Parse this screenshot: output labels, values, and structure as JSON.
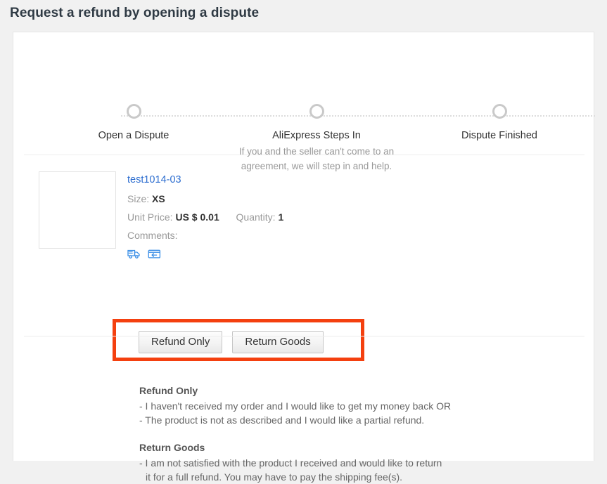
{
  "page": {
    "title": "Request a refund by opening a dispute"
  },
  "stepper": {
    "steps": [
      {
        "label": "Open a Dispute",
        "description": ""
      },
      {
        "label": "AliExpress Steps In",
        "description": "If you and the seller can't come to an agreement, we will step in and help."
      },
      {
        "label": "Dispute Finished",
        "description": ""
      }
    ]
  },
  "product": {
    "name": "test1014-03",
    "size_label": "Size:",
    "size_value": "XS",
    "unit_price_label": "Unit Price:",
    "unit_price_value": "US $ 0.01",
    "quantity_label": "Quantity:",
    "quantity_value": "1",
    "comments_label": "Comments:",
    "comments_value": "",
    "icons": [
      {
        "name": "shipping-truck-icon"
      },
      {
        "name": "return-package-icon"
      }
    ]
  },
  "actions": {
    "refund_only_label": "Refund Only",
    "return_goods_label": "Return Goods",
    "highlight_color": "#f4400f"
  },
  "explanations": [
    {
      "heading": "Refund Only",
      "lines": [
        "- I haven't received my order and I would like to get my money back OR",
        "- The product is not as described and I would like a partial refund."
      ]
    },
    {
      "heading": "Return Goods",
      "lines": [
        "- I am not satisfied with the product I received and would like to return",
        "it for a full refund. You may have to pay the shipping fee(s)."
      ]
    }
  ],
  "colors": {
    "link": "#2f6fd0",
    "page_background": "#f1f1f1",
    "card_background": "#ffffff"
  }
}
